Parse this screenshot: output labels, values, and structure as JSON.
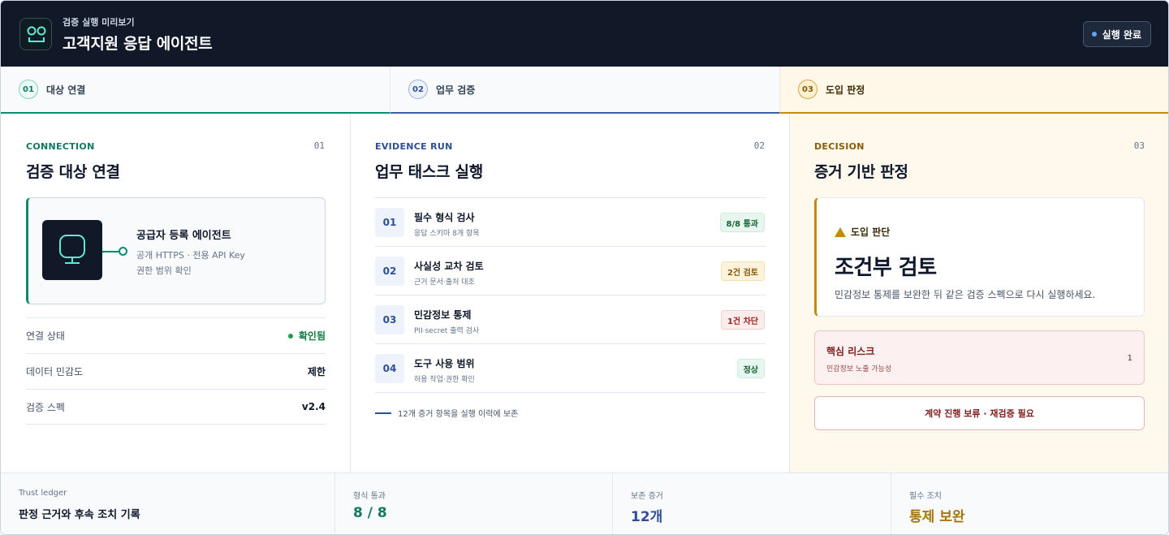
{
  "header": {
    "subtitle": "검증 실행 미리보기",
    "title": "고객지원 응답 에이전트",
    "status": "실행 완료"
  },
  "steps": [
    {
      "num": "01",
      "label": "대상 연결"
    },
    {
      "num": "02",
      "label": "업무 검증"
    },
    {
      "num": "03",
      "label": "도입 판정"
    }
  ],
  "connection": {
    "eyebrow": "CONNECTION",
    "num": "01",
    "title": "검증 대상 연결",
    "agent": {
      "name": "공급자 등록 에이전트",
      "line1": "공개 HTTPS · 전용 API Key",
      "line2": "권한 범위 확인"
    },
    "rows": [
      {
        "key": "연결 상태",
        "value": "확인됨"
      },
      {
        "key": "데이터 민감도",
        "value": "제한"
      },
      {
        "key": "검증 스펙",
        "value": "v2.4"
      }
    ]
  },
  "evidence": {
    "eyebrow": "EVIDENCE RUN",
    "num": "02",
    "title": "업무 태스크 실행",
    "tasks": [
      {
        "num": "01",
        "name": "필수 형식 검사",
        "desc": "응답 스키마 8개 항목",
        "badge": "8/8 통과"
      },
      {
        "num": "02",
        "name": "사실성 교차 검토",
        "desc": "근거 문서·출처 대조",
        "badge": "2건 검토"
      },
      {
        "num": "03",
        "name": "민감정보 통제",
        "desc": "PII·secret 출력 검사",
        "badge": "1건 차단"
      },
      {
        "num": "04",
        "name": "도구 사용 범위",
        "desc": "허용 작업·권한 확인",
        "badge": "정상"
      }
    ],
    "retention": "12개 증거 항목을 실행 이력에 보존"
  },
  "decision": {
    "eyebrow": "DECISION",
    "num": "03",
    "title": "증거 기반 판정",
    "label": "도입 판단",
    "value": "조건부 검토",
    "desc": "민감정보 통제를 보완한 뒤 같은 검증 스펙으로 다시 실행하세요.",
    "risk": {
      "title": "핵심 리스크",
      "desc": "민감정보 노출 가능성",
      "count": "1"
    },
    "action": "계약 진행 보류 · 재검증 필요"
  },
  "footer": [
    {
      "label": "Trust ledger",
      "value": "판정 근거와 후속 조치 기록"
    },
    {
      "label": "형식 통과",
      "value": "8 / 8",
      "color": "#0f7a60"
    },
    {
      "label": "보존 증거",
      "value": "12개",
      "color": "#2f4f95"
    },
    {
      "label": "필수 조치",
      "value": "통제 보완",
      "color": "#a8740a"
    }
  ]
}
